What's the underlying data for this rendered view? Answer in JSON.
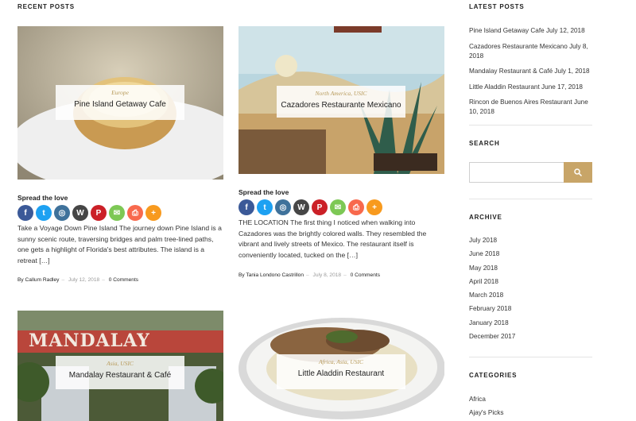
{
  "recent_posts": {
    "heading": "RECENT POSTS",
    "spread_label": "Spread the love",
    "by_label": "By",
    "comments_label": "0 Comments",
    "posts": [
      {
        "category": "Europe",
        "title": "Pine Island Getaway Cafe",
        "excerpt": "Take a Voyage Down Pine Island The journey down Pine Island is a sunny scenic route, traversing bridges and palm tree-lined paths, one gets a highlight of Florida's best attributes. The island is a retreat […]",
        "author": "Callum Radley",
        "date": "July 12, 2018"
      },
      {
        "category": "North America, USIC",
        "title": "Cazadores Restaurante Mexicano",
        "excerpt": " THE LOCATION The first thing I noticed when walking into Cazadores was the brightly colored walls. They resembled the vibrant and lively streets of Mexico. The restaurant itself is conveniently located, tucked on the […]",
        "author": "Tania Londono Castrillon",
        "date": "July 8, 2018"
      },
      {
        "category": "Asia, USIC",
        "title": "Mandalay Restaurant & Café",
        "image_sign": "MANDALAY"
      },
      {
        "category": "Africa, Asia, USIC",
        "title": "Little Aladdin Restaurant"
      }
    ],
    "share_icons": [
      {
        "name": "facebook-icon",
        "glyph": "f",
        "color": "#3b5998"
      },
      {
        "name": "twitter-icon",
        "glyph": "t",
        "color": "#1da1f2"
      },
      {
        "name": "instagram-icon",
        "glyph": "◎",
        "color": "#3f729b"
      },
      {
        "name": "wordpress-icon",
        "glyph": "W",
        "color": "#464646"
      },
      {
        "name": "pinterest-icon",
        "glyph": "P",
        "color": "#cb2027"
      },
      {
        "name": "email-icon",
        "glyph": "✉",
        "color": "#7dc855"
      },
      {
        "name": "print-icon",
        "glyph": "⎙",
        "color": "#f8694d"
      },
      {
        "name": "more-icon",
        "glyph": "+",
        "color": "#f89a1e"
      }
    ]
  },
  "sidebar": {
    "latest_heading": "LATEST POSTS",
    "latest_posts": [
      {
        "title": "Pine Island Getaway Cafe",
        "date": "July 12, 2018"
      },
      {
        "title": "Cazadores Restaurante Mexicano",
        "date": "July 8, 2018"
      },
      {
        "title": "Mandalay Restaurant & Café",
        "date": "July 1, 2018"
      },
      {
        "title": "Little Aladdin Restaurant",
        "date": "June 17, 2018"
      },
      {
        "title": "Rincon de Buenos Aires Restaurant",
        "date": "June 10, 2018"
      }
    ],
    "search_heading": "SEARCH",
    "search_placeholder": "",
    "search_button_icon": "search-icon",
    "archive_heading": "ARCHIVE",
    "archive": [
      "July 2018",
      "June 2018",
      "May 2018",
      "April 2018",
      "March 2018",
      "February 2018",
      "January 2018",
      "December 2017"
    ],
    "categories_heading": "CATEGORIES",
    "categories": [
      "Africa",
      "Ajay's Picks"
    ]
  },
  "colors": {
    "accent": "#c8a568",
    "category_text": "#b79a5a"
  }
}
